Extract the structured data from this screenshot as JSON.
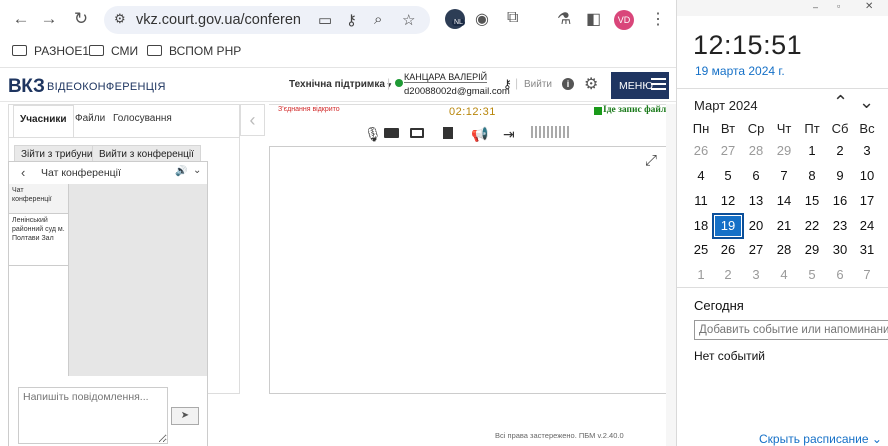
{
  "browser": {
    "url": "vkz.court.gov.ua/conference?id...",
    "profile_initials": "VD",
    "extension_badge": "NL",
    "bookmarks": [
      "РАЗНОЕ1",
      "СМИ",
      "ВСПОМ PHP"
    ]
  },
  "site": {
    "logo": "ВКЗ",
    "logo_sub": "ВІДЕОКОНФЕРЕНЦІЯ",
    "support_label": "Технічна підтримка",
    "user_name": "КАНЦАРА ВАЛЕРІЙ",
    "user_email": "d20088002d@gmail.com",
    "logout_label": "Вийти",
    "menu_label": "МЕНЮ",
    "footer": "Всі права застережено. ПБМ v.2.40.0"
  },
  "left_panel": {
    "tabs": [
      "Учасники",
      "Файли",
      "Голосування"
    ],
    "active_tab": "Учасники",
    "join_button": "Зійти з трибуни",
    "exit_button": "Вийти з конференції"
  },
  "chat": {
    "title": "Чат конференції",
    "items": [
      "Чат конференції",
      "Ленінський районний суд м. Полтави Зал"
    ],
    "placeholder": "Напишіть повідомлення..."
  },
  "video": {
    "connection_status": "З'єднання відкрито",
    "timer": "02:12:31",
    "recording_label": "Іде запис файлу",
    "colors": {
      "connection": "#d22a2a",
      "timer": "#b8860b",
      "recording": "#1a7a1a"
    }
  },
  "calendar": {
    "time": "12:15:51",
    "date": "19 марта 2024 г.",
    "month_title": "Март 2024",
    "weekdays": [
      "Пн",
      "Вт",
      "Ср",
      "Чт",
      "Пт",
      "Сб",
      "Вс"
    ],
    "weeks": [
      [
        "26",
        "27",
        "28",
        "29",
        "1",
        "2",
        "3"
      ],
      [
        "4",
        "5",
        "6",
        "7",
        "8",
        "9",
        "10"
      ],
      [
        "11",
        "12",
        "13",
        "14",
        "15",
        "16",
        "17"
      ],
      [
        "18",
        "19",
        "20",
        "21",
        "22",
        "23",
        "24"
      ],
      [
        "25",
        "26",
        "27",
        "28",
        "29",
        "30",
        "31"
      ],
      [
        "1",
        "2",
        "3",
        "4",
        "5",
        "6",
        "7"
      ]
    ],
    "today": "19",
    "today_label": "Сегодня",
    "add_event_placeholder": "Добавить событие или напоминание",
    "no_events": "Нет событий",
    "hide_schedule": "Скрыть расписание",
    "accent": "#1570c7"
  }
}
